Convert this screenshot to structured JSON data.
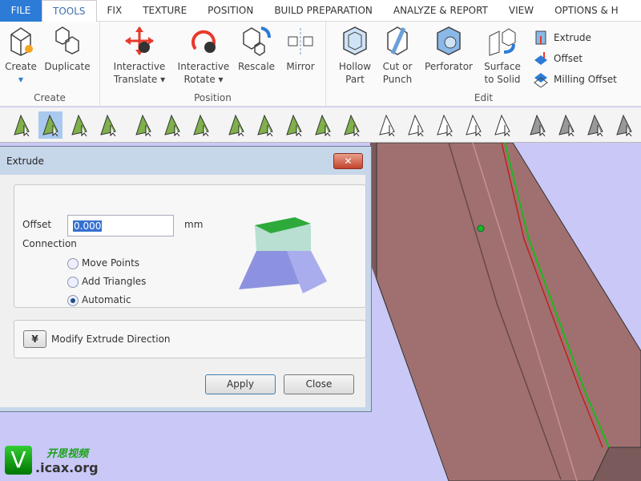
{
  "tabs": [
    "FILE",
    "TOOLS",
    "FIX",
    "TEXTURE",
    "POSITION",
    "BUILD PREPARATION",
    "ANALYZE & REPORT",
    "VIEW",
    "OPTIONS & H"
  ],
  "ribbon": {
    "create": {
      "label": "Create",
      "buttons": [
        "Create",
        "Duplicate"
      ]
    },
    "position": {
      "label": "Position",
      "buttons": [
        "Interactive",
        "Translate ▾",
        "Interactive",
        "Rotate ▾",
        "Rescale",
        "Mirror"
      ]
    },
    "edit": {
      "label": "Edit",
      "buttons": [
        "Hollow",
        "Part",
        "Cut or",
        "Punch",
        "Perforator",
        "Surface",
        "to Solid"
      ],
      "small": [
        "Extrude",
        "Offset",
        "Milling Offset"
      ]
    }
  },
  "dialog": {
    "title": "Extrude",
    "close_x": "✕",
    "offset_label": "Offset",
    "offset_value": "0.000",
    "unit": "mm",
    "connection_label": "Connection",
    "options": [
      "Move Points",
      "Add Triangles",
      "Automatic"
    ],
    "selected": "Automatic",
    "modify": "Modify Extrude Direction",
    "expand_glyph": "¥",
    "apply": "Apply",
    "close": "Close"
  },
  "watermark": {
    "cn": "开思视频",
    "site": ".icax.org",
    "v": "V"
  },
  "colors": {
    "viewport": "#c9c8f7",
    "part": "#9a6a6a",
    "accent": "#2c7bd6"
  }
}
